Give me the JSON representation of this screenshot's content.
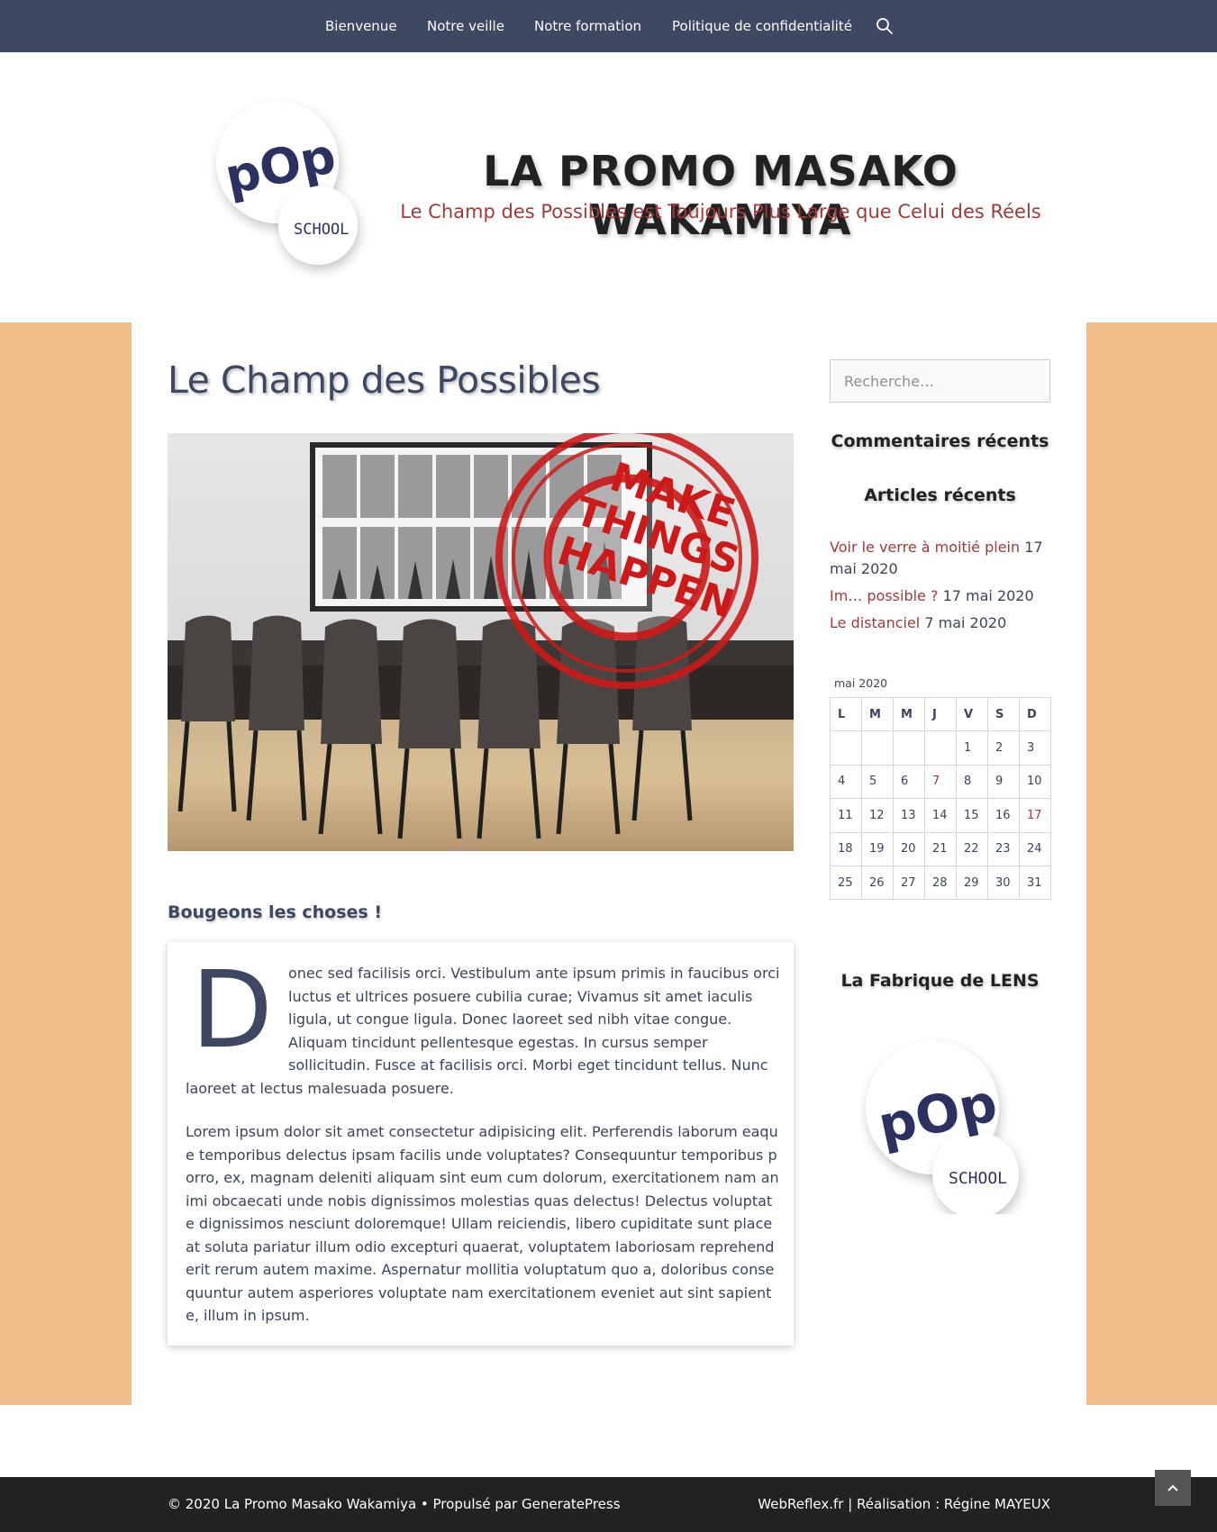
{
  "nav": {
    "items": [
      {
        "label": "Bienvenue"
      },
      {
        "label": "Notre veille"
      },
      {
        "label": "Notre formation"
      },
      {
        "label": "Politique de confidentialité"
      }
    ],
    "search_icon": "search-icon"
  },
  "header": {
    "title": "LA PROMO MASAKO WAKAMIYA",
    "tagline": "Le Champ des Possibles est Toujours Plus Large que Celui des Réels",
    "logo": {
      "word1": "pOp",
      "word2": "SCHOOL"
    }
  },
  "main": {
    "page_title": "Le Champ des Possibles",
    "hero": {
      "stamp_lines": [
        "MAKE",
        "THINGS",
        "HAPPEN"
      ]
    },
    "section_title": "Bougeons les choses !",
    "dropcap": "D",
    "paragraph1": "onec sed facilisis orci. Vestibulum ante ipsum primis in faucibus orci luctus et ultrices posuere cubilia curae; Vivamus sit amet iaculis ligula, ut congue ligula. Donec laoreet sed nibh vitae congue. Aliquam tincidunt pellentesque egestas. In cursus semper sollicitudin. Fusce at facilisis orci. Morbi eget tincidunt tellus. Nunc laoreet at lectus malesuada posuere.",
    "paragraph2": "Lorem ipsum dolor sit amet consectetur adipisicing elit. Perferendis laborum eaque  temporibus delectus ipsam facilis unde voluptates? Consequuntur temporibus porro, ex, magnam deleniti aliquam sint eum cum dolorum, exercitationem nam animi obcaecati unde nobis dignissimos molestias quas delectus! Delectus voluptate dignissimos nesciunt doloremque! Ullam reiciendis, libero cupiditate sunt placeat soluta pariatur illum odio excepturi quaerat, voluptatem laboriosam reprehenderit rerum autem maxime. Aspernatur mollitia voluptatum quo a, doloribus consequuntur autem asperiores voluptate nam exercitationem eveniet aut sint sapiente, illum in ipsum."
  },
  "sidebar": {
    "search_placeholder": "Recherche…",
    "recent_comments_title": "Commentaires récents",
    "recent_posts_title": "Articles récents",
    "recent_posts": [
      {
        "title": "Voir le verre à moitié plein",
        "date": "17 mai 2020"
      },
      {
        "title": "Im… possible ?",
        "date": "17 mai 2020"
      },
      {
        "title": "Le distanciel",
        "date": "7 mai 2020"
      }
    ],
    "calendar": {
      "caption": "mai 2020",
      "headers": [
        "L",
        "M",
        "M",
        "J",
        "V",
        "S",
        "D"
      ],
      "rows": [
        [
          "",
          "",
          "",
          "",
          "1",
          "2",
          "3"
        ],
        [
          "4",
          "5",
          "6",
          "7",
          "8",
          "9",
          "10"
        ],
        [
          "11",
          "12",
          "13",
          "14",
          "15",
          "16",
          "17"
        ],
        [
          "18",
          "19",
          "20",
          "21",
          "22",
          "23",
          "24"
        ],
        [
          "25",
          "26",
          "27",
          "28",
          "29",
          "30",
          "31"
        ]
      ],
      "linked_days": [
        "7",
        "17"
      ]
    },
    "fabrique_title": "La Fabrique de LENS"
  },
  "footer": {
    "left": "© 2020 La Promo Masako Wakamiya • Propulsé par GeneratePress",
    "right": "WebReflex.fr | Réalisation : Régine MAYEUX",
    "back_to_top_icon": "chevron-up-icon"
  },
  "colors": {
    "nav_bg": "#3e4863",
    "accent_red": "#a03a3a",
    "band_orange": "#f1be8c",
    "footer_bg": "#222222"
  }
}
